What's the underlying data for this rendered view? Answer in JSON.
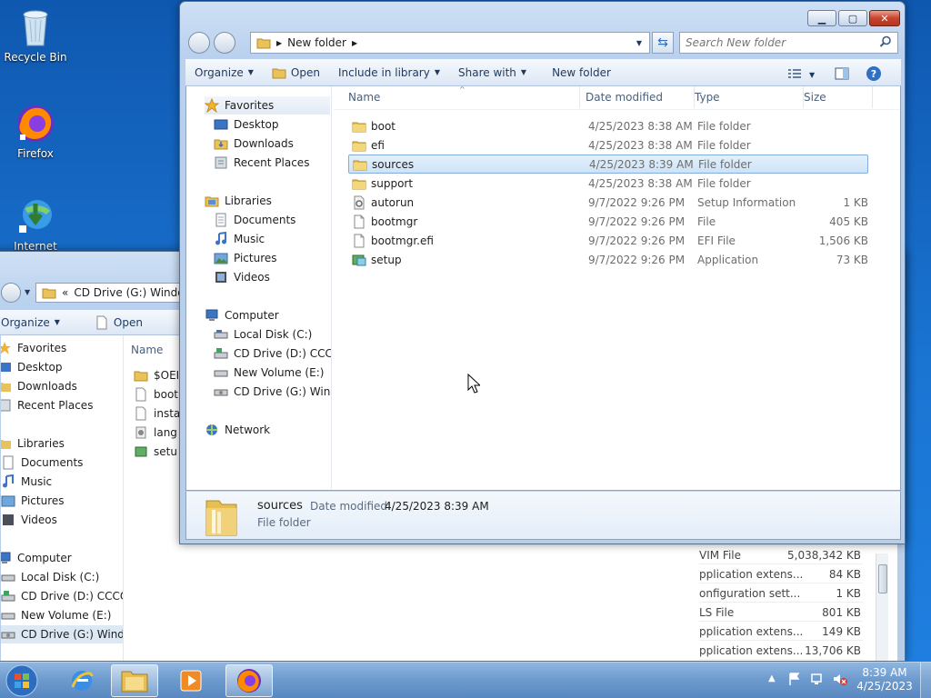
{
  "desktop": {
    "icons": [
      {
        "label": "Recycle Bin",
        "icon": "recycle-bin-icon"
      },
      {
        "label": "Firefox",
        "icon": "firefox-icon"
      },
      {
        "label": "Internet",
        "icon": "download-manager-icon"
      }
    ]
  },
  "back_window": {
    "address": "CD Drive (G:) Windo",
    "address_prefix": "«",
    "toolbar": {
      "organize": "Organize",
      "open": "Open"
    },
    "nav": {
      "favorites": "Favorites",
      "desktop": "Desktop",
      "downloads": "Downloads",
      "recent": "Recent Places",
      "libraries": "Libraries",
      "documents": "Documents",
      "music": "Music",
      "pictures": "Pictures",
      "videos": "Videos",
      "computer": "Computer",
      "local_disk": "Local Disk (C:)",
      "cd_d": "CD Drive (D:) CCCOI",
      "new_volume": "New Volume (E:)",
      "cd_g": "CD Drive (G:) Windo"
    },
    "col_name": "Name",
    "files": [
      "$OEI",
      "boot",
      "insta",
      "lang",
      "setu"
    ],
    "right_rows": [
      {
        "type": "VIM File",
        "size": "5,038,342 KB"
      },
      {
        "type": "pplication extens...",
        "size": "84 KB"
      },
      {
        "type": "onfiguration sett...",
        "size": "1 KB"
      },
      {
        "type": "LS File",
        "size": "801 KB"
      },
      {
        "type": "pplication extens...",
        "size": "149 KB"
      },
      {
        "type": "pplication extens...",
        "size": "13,706 KB"
      }
    ]
  },
  "front_window": {
    "breadcrumb": "New folder",
    "search_placeholder": "Search New folder",
    "toolbar": {
      "organize": "Organize",
      "open": "Open",
      "include": "Include in library",
      "share": "Share with",
      "new_folder": "New folder"
    },
    "nav": {
      "favorites": "Favorites",
      "desktop": "Desktop",
      "downloads": "Downloads",
      "recent": "Recent Places",
      "libraries": "Libraries",
      "documents": "Documents",
      "music": "Music",
      "pictures": "Pictures",
      "videos": "Videos",
      "computer": "Computer",
      "local_disk": "Local Disk (C:)",
      "cd_d": "CD Drive (D:) CCCOI",
      "new_volume": "New Volume (E:)",
      "cd_g": "CD Drive (G:) Windo",
      "network": "Network"
    },
    "columns": {
      "name": "Name",
      "date": "Date modified",
      "type": "Type",
      "size": "Size"
    },
    "files": [
      {
        "name": "boot",
        "date": "4/25/2023 8:38 AM",
        "type": "File folder",
        "size": "",
        "icon": "folder-icon"
      },
      {
        "name": "efi",
        "date": "4/25/2023 8:38 AM",
        "type": "File folder",
        "size": "",
        "icon": "folder-icon"
      },
      {
        "name": "sources",
        "date": "4/25/2023 8:39 AM",
        "type": "File folder",
        "size": "",
        "icon": "folder-icon"
      },
      {
        "name": "support",
        "date": "4/25/2023 8:38 AM",
        "type": "File folder",
        "size": "",
        "icon": "folder-icon"
      },
      {
        "name": "autorun",
        "date": "9/7/2022 9:26 PM",
        "type": "Setup Information",
        "size": "1 KB",
        "icon": "settings-file-icon"
      },
      {
        "name": "bootmgr",
        "date": "9/7/2022 9:26 PM",
        "type": "File",
        "size": "405 KB",
        "icon": "file-icon"
      },
      {
        "name": "bootmgr.efi",
        "date": "9/7/2022 9:26 PM",
        "type": "EFI File",
        "size": "1,506 KB",
        "icon": "file-icon"
      },
      {
        "name": "setup",
        "date": "9/7/2022 9:26 PM",
        "type": "Application",
        "size": "73 KB",
        "icon": "setup-app-icon"
      }
    ],
    "details": {
      "name": "sources",
      "date_label": "Date modified:",
      "date_value": "4/25/2023 8:39 AM",
      "type": "File folder"
    }
  },
  "taskbar": {
    "time": "8:39 AM",
    "date": "4/25/2023"
  }
}
